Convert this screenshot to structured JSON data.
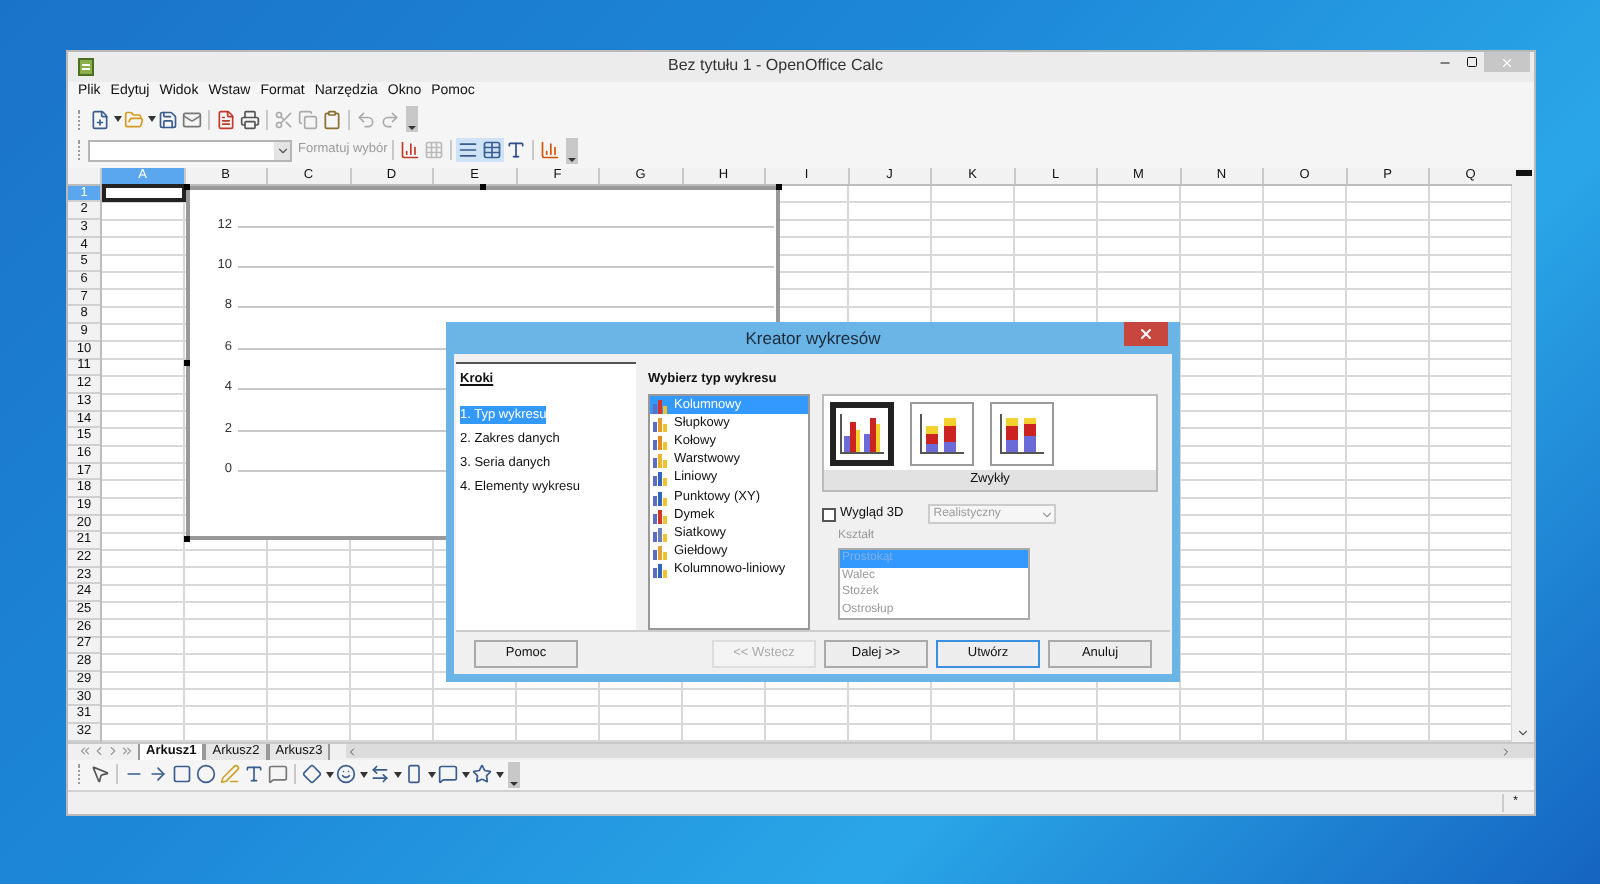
{
  "window": {
    "title": "Bez tytułu 1 - OpenOffice Calc"
  },
  "menu": [
    {
      "label": "Plik"
    },
    {
      "label": "Edytuj"
    },
    {
      "label": "Widok"
    },
    {
      "label": "Wstaw"
    },
    {
      "label": "Format"
    },
    {
      "label": "Narzędzia"
    },
    {
      "label": "Okno"
    },
    {
      "label": "Pomoc"
    }
  ],
  "formatting_toolbar": {
    "format_selection": {
      "label": "Formatuj wybór",
      "disabled": true
    }
  },
  "sheet": {
    "columns": [
      {
        "label": "A",
        "selected": true
      },
      {
        "label": "B",
        "selected": false
      },
      {
        "label": "C",
        "selected": false
      },
      {
        "label": "D",
        "selected": false
      },
      {
        "label": "E",
        "selected": false
      },
      {
        "label": "F",
        "selected": false
      },
      {
        "label": "G",
        "selected": false
      },
      {
        "label": "H",
        "selected": false
      },
      {
        "label": "I",
        "selected": false
      },
      {
        "label": "J",
        "selected": false
      },
      {
        "label": "K",
        "selected": false
      },
      {
        "label": "L",
        "selected": false
      },
      {
        "label": "M",
        "selected": false
      },
      {
        "label": "N",
        "selected": false
      },
      {
        "label": "O",
        "selected": false
      },
      {
        "label": "P",
        "selected": false
      },
      {
        "label": "Q",
        "selected": false
      }
    ],
    "rows": [
      {
        "label": "1",
        "selected": true
      },
      {
        "label": "2",
        "selected": false
      },
      {
        "label": "3",
        "selected": false
      },
      {
        "label": "4",
        "selected": false
      },
      {
        "label": "5",
        "selected": false
      },
      {
        "label": "6",
        "selected": false
      },
      {
        "label": "7",
        "selected": false
      },
      {
        "label": "8",
        "selected": false
      },
      {
        "label": "9",
        "selected": false
      },
      {
        "label": "10",
        "selected": false
      },
      {
        "label": "11",
        "selected": false
      },
      {
        "label": "12",
        "selected": false
      },
      {
        "label": "13",
        "selected": false
      },
      {
        "label": "14",
        "selected": false
      },
      {
        "label": "15",
        "selected": false
      },
      {
        "label": "16",
        "selected": false
      },
      {
        "label": "17",
        "selected": false
      },
      {
        "label": "18",
        "selected": false
      },
      {
        "label": "19",
        "selected": false
      },
      {
        "label": "20",
        "selected": false
      },
      {
        "label": "21",
        "selected": false
      },
      {
        "label": "22",
        "selected": false
      },
      {
        "label": "23",
        "selected": false
      },
      {
        "label": "24",
        "selected": false
      },
      {
        "label": "25",
        "selected": false
      },
      {
        "label": "26",
        "selected": false
      },
      {
        "label": "27",
        "selected": false
      },
      {
        "label": "28",
        "selected": false
      },
      {
        "label": "29",
        "selected": false
      },
      {
        "label": "30",
        "selected": false
      },
      {
        "label": "31",
        "selected": false
      },
      {
        "label": "32",
        "selected": false
      }
    ]
  },
  "chart": {
    "y_axis_labels": [
      "12",
      "10",
      "8",
      "6",
      "4",
      "2",
      "0"
    ]
  },
  "sheet_tabs": [
    {
      "label": "Arkusz1",
      "selected": true
    },
    {
      "label": "Arkusz2",
      "selected": false
    },
    {
      "label": "Arkusz3",
      "selected": false
    }
  ],
  "status_bar": {
    "modified_mark": "*"
  },
  "dialog": {
    "title": "Kreator wykresów",
    "steps_heading": "Kroki",
    "steps": [
      {
        "label": "1. Typ wykresu",
        "selected": true
      },
      {
        "label": "2. Zakres danych",
        "selected": false
      },
      {
        "label": "3. Seria danych",
        "selected": false
      },
      {
        "label": "4. Elementy wykresu",
        "selected": false
      }
    ],
    "chart_type_heading": "Wybierz typ wykresu",
    "chart_types": [
      {
        "label": "Kolumnowy",
        "selected": true
      },
      {
        "label": "Słupkowy",
        "selected": false
      },
      {
        "label": "Kołowy",
        "selected": false
      },
      {
        "label": "Warstwowy",
        "selected": false
      },
      {
        "label": "Liniowy",
        "selected": false
      },
      {
        "label": "Punktowy (XY)",
        "selected": false
      },
      {
        "label": "Dymek",
        "selected": false
      },
      {
        "label": "Siatkowy",
        "selected": false
      },
      {
        "label": "Giełdowy",
        "selected": false
      },
      {
        "label": "Kolumnowo-liniowy",
        "selected": false
      }
    ],
    "variants": [
      {
        "kind": "grouped",
        "selected": true
      },
      {
        "kind": "stacked",
        "selected": false
      },
      {
        "kind": "percent",
        "selected": false
      }
    ],
    "variant_label": "Zwykły",
    "view_3d": {
      "label": "Wygląd 3D",
      "checked": false
    },
    "style_select": {
      "value": "Realistyczny",
      "disabled": true
    },
    "shape_label": {
      "label": "Kształt",
      "disabled": true
    },
    "shapes": [
      {
        "label": "Prostokąt",
        "selected": true
      },
      {
        "label": "Walec",
        "selected": false
      },
      {
        "label": "Stożek",
        "selected": false
      },
      {
        "label": "Ostrosłup",
        "selected": false
      }
    ],
    "buttons": [
      {
        "label": "Pomoc",
        "disabled": false,
        "default": false
      },
      {
        "label": "<< Wstecz",
        "disabled": true,
        "default": false
      },
      {
        "label": "Dalej >>",
        "disabled": false,
        "default": false
      },
      {
        "label": "Utwórz",
        "disabled": false,
        "default": true
      },
      {
        "label": "Anuluj",
        "disabled": false,
        "default": false
      }
    ]
  }
}
